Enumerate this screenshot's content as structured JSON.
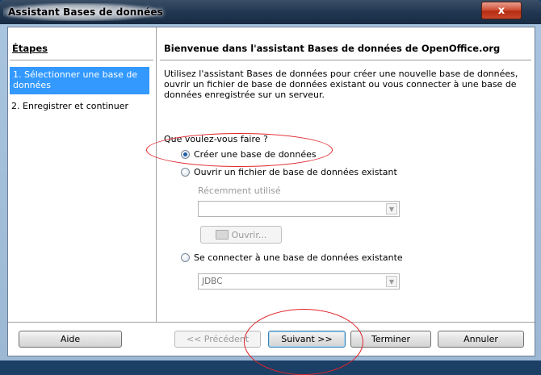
{
  "window": {
    "title": "Assistant Bases de données",
    "close_label": "x"
  },
  "steps": {
    "heading": "Étapes",
    "items": [
      {
        "label": "1. Sélectionner une base de données",
        "active": true
      },
      {
        "label": "2. Enregistrer et continuer",
        "active": false
      }
    ]
  },
  "main": {
    "title": "Bienvenue dans l'assistant Bases de données de OpenOffice.org",
    "intro": "Utilisez l'assistant Bases de données pour créer une nouvelle base de données, ouvrir un fichier de base de données existant ou vous connecter à une base de données enregistrée sur un serveur.",
    "question": "Que voulez-vous faire ?",
    "options": {
      "create": {
        "label": "Créer une base de données",
        "checked": true
      },
      "open": {
        "label": "Ouvrir un fichier de base de données existant",
        "checked": false
      },
      "connect": {
        "label": "Se connecter à une base de données existante",
        "checked": false
      }
    },
    "recent_label": "Récemment utilisé",
    "recent_value": "",
    "open_button": "Ouvrir...",
    "connection_type": "JDBC"
  },
  "buttons": {
    "help": "Aide",
    "back": "<< Précédent",
    "next": "Suivant >>",
    "finish": "Terminer",
    "cancel": "Annuler"
  },
  "colors": {
    "selection": "#3399ff",
    "annotation": "#e0242a"
  }
}
